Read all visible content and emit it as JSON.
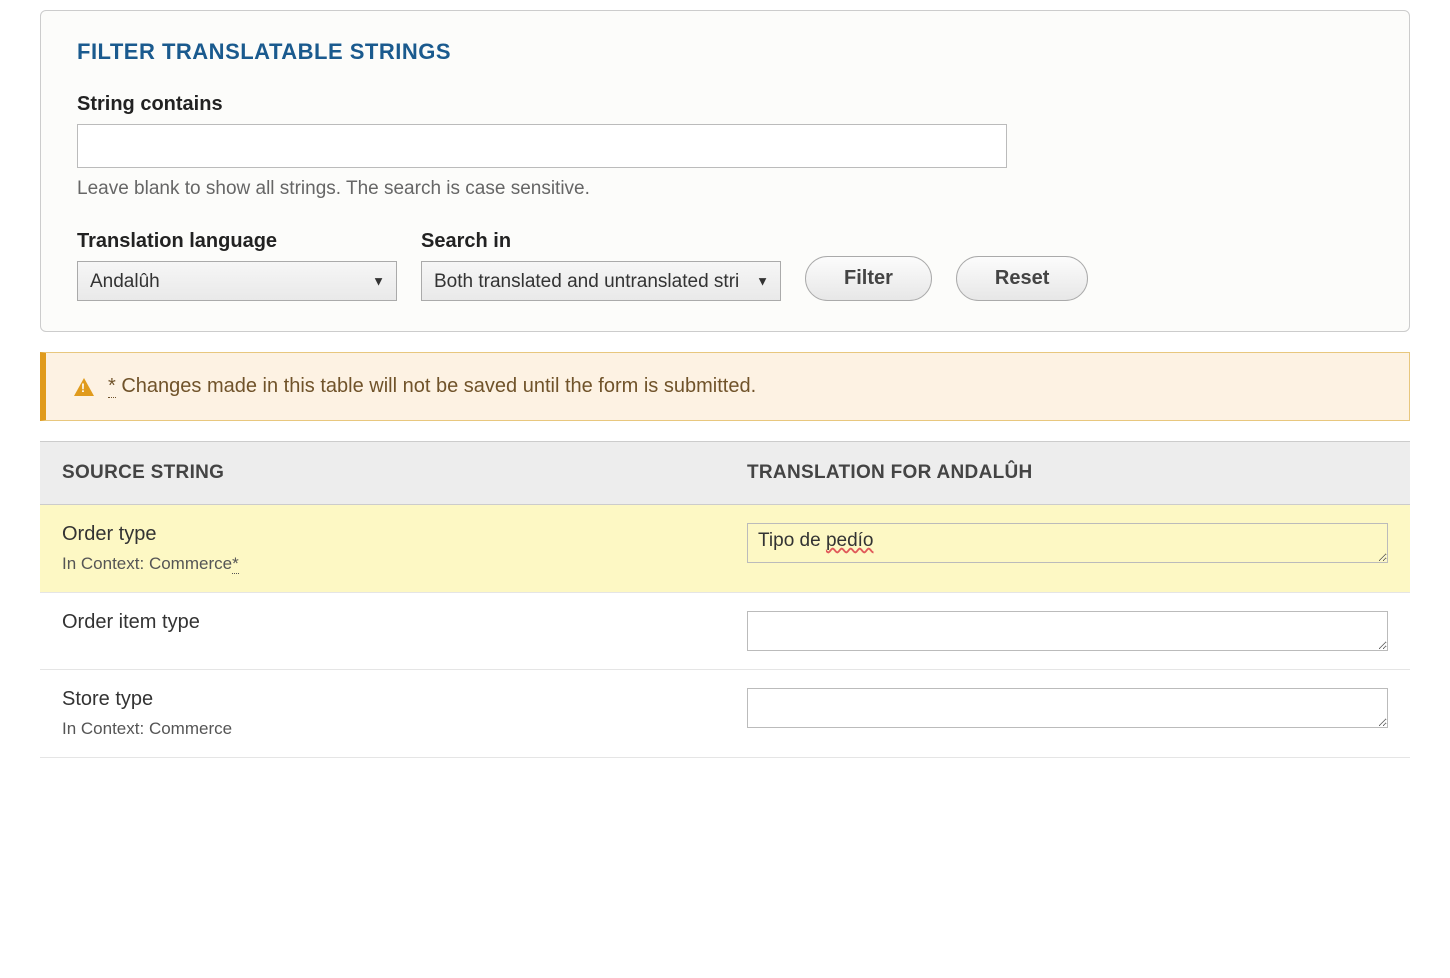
{
  "filter": {
    "title": "FILTER TRANSLATABLE STRINGS",
    "string_contains_label": "String contains",
    "string_contains_value": "",
    "string_contains_help": "Leave blank to show all strings. The search is case sensitive.",
    "translation_language_label": "Translation language",
    "translation_language_value": "Andalûh",
    "search_in_label": "Search in",
    "search_in_value": "Both translated and untranslated strings",
    "filter_button": "Filter",
    "reset_button": "Reset"
  },
  "warning": {
    "marker": "*",
    "text": " Changes made in this table will not be saved until the form is submitted."
  },
  "table": {
    "col_source": "SOURCE STRING",
    "col_translation": "TRANSLATION FOR ANDALÛH",
    "rows": [
      {
        "source": "Order type",
        "context_prefix": "In Context: ",
        "context": "Commerce",
        "context_marker": "*",
        "translation_prefix": "Tipo de ",
        "translation_spell": "pedío",
        "modified": true
      },
      {
        "source": "Order item type",
        "context_prefix": "",
        "context": "",
        "context_marker": "",
        "translation_prefix": "",
        "translation_spell": "",
        "modified": false
      },
      {
        "source": "Store type",
        "context_prefix": "In Context: ",
        "context": "Commerce",
        "context_marker": "",
        "translation_prefix": "",
        "translation_spell": "",
        "modified": false
      }
    ]
  }
}
